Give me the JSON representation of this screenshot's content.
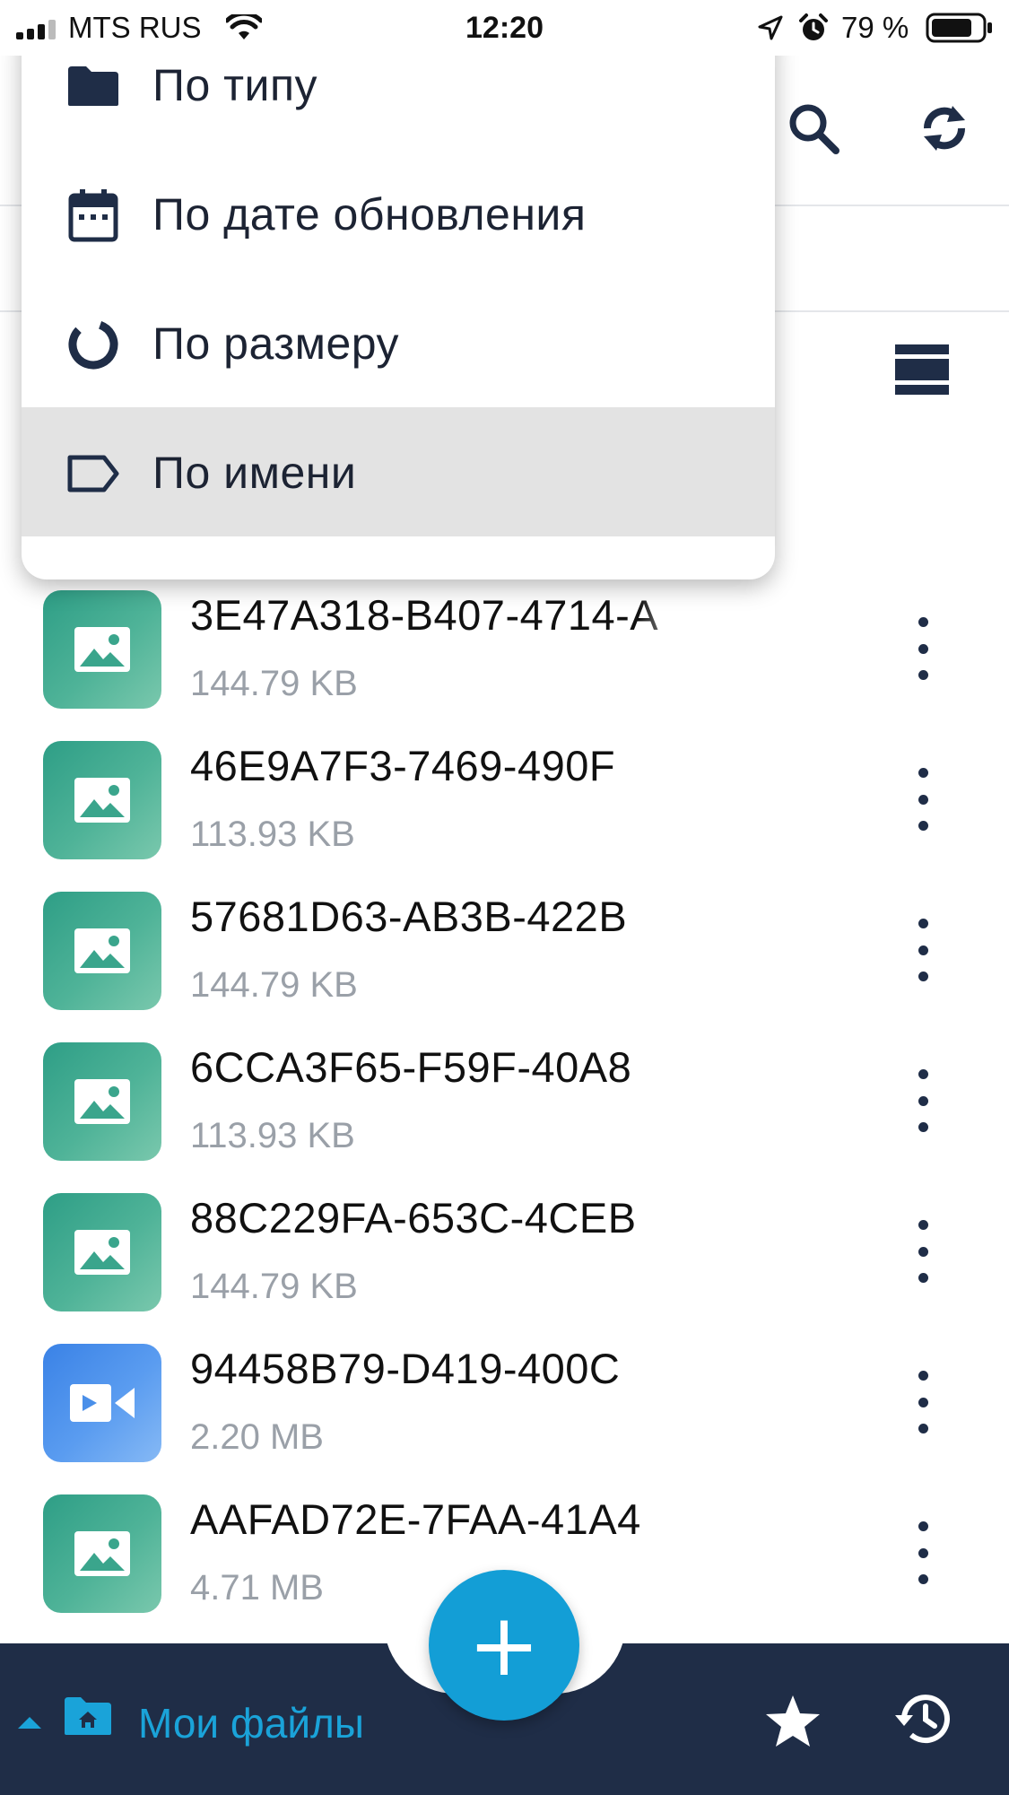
{
  "status_bar": {
    "carrier": "MTS RUS",
    "time": "12:20",
    "battery": "79 %"
  },
  "header": {
    "search_icon": "search-icon",
    "sync_icon": "sync-icon"
  },
  "sort_menu": {
    "items": [
      {
        "label": "По типу",
        "icon": "folder-icon",
        "selected": false
      },
      {
        "label": "По дате обновления",
        "icon": "calendar-icon",
        "selected": false
      },
      {
        "label": "По размеру",
        "icon": "donut-chart-icon",
        "selected": false
      },
      {
        "label": "По имени",
        "icon": "label-tag-icon",
        "selected": true
      }
    ]
  },
  "files": [
    {
      "name": "3E47A318-B407-4714-A",
      "size": "144.79 KB",
      "type": "image"
    },
    {
      "name": "46E9A7F3-7469-490F",
      "size": "113.93 KB",
      "type": "image"
    },
    {
      "name": "57681D63-AB3B-422B",
      "size": "144.79 KB",
      "type": "image"
    },
    {
      "name": "6CCA3F65-F59F-40A8",
      "size": "113.93 KB",
      "type": "image"
    },
    {
      "name": "88C229FA-653C-4CEB",
      "size": "144.79 KB",
      "type": "image"
    },
    {
      "name": "94458B79-D419-400C",
      "size": "2.20 MB",
      "type": "video"
    },
    {
      "name": "AAFAD72E-7FAA-41A4",
      "size": "4.71 MB",
      "type": "image"
    }
  ],
  "bottom_bar": {
    "folder_label": "Мои файлы",
    "fab_label": "+"
  },
  "colors": {
    "accent": "#139ed6",
    "nav_background": "#1f2d47",
    "image_thumb": "#3aa58c",
    "video_thumb": "#4a8fe9",
    "menu_selected": "#e3e3e3"
  }
}
